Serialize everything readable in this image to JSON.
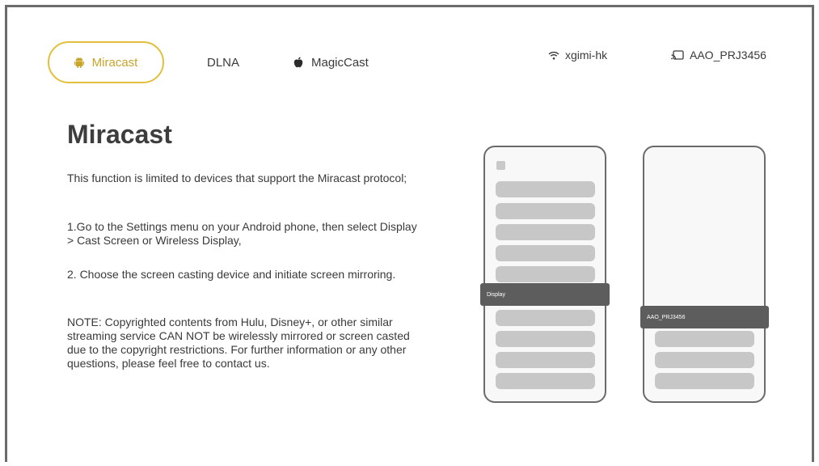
{
  "tabs": [
    {
      "label": "Miracast",
      "icon": "android-icon",
      "active": true
    },
    {
      "label": "DLNA",
      "icon": "",
      "active": false
    },
    {
      "label": "MagicCast",
      "icon": "apple-icon",
      "active": false
    }
  ],
  "status": {
    "wifi_name": "xgimi-hk",
    "device_name": "AAO_PRJ3456"
  },
  "content": {
    "title": "Miracast",
    "paragraphs": [
      "This function is limited to devices that support the Miracast protocol;",
      "1.Go to the Settings menu on your Android phone, then select Display > Cast Screen or Wireless Display,",
      "2. Choose the screen casting device and initiate screen mirroring.",
      "NOTE: Copyrighted contents from Hulu, Disney+, or other similar streaming service CAN NOT be wirelessly mirrored or screen casted due to the copyright restrictions. For further information or any other questions, please feel free to contact us."
    ]
  },
  "illustration": {
    "left_highlight": "Display",
    "right_highlight": "AAO_PRJ3456"
  },
  "colors": {
    "accent": "#e3bf3c",
    "accent_text": "#c9a42a",
    "bar": "#c7c7c7",
    "highlight": "#5d5d5d"
  }
}
